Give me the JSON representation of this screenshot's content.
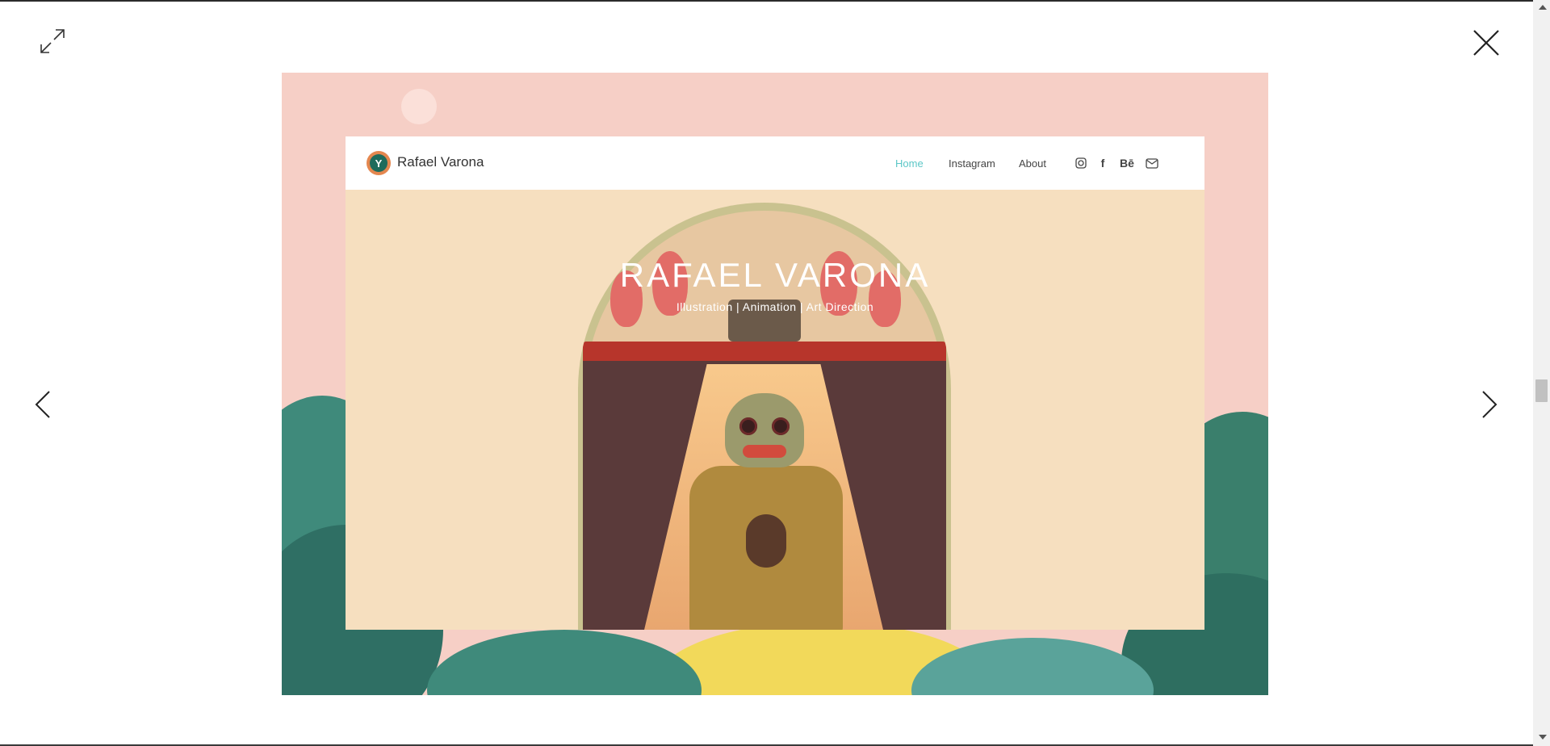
{
  "controls": {
    "expand_icon": "expand-arrows",
    "close_icon": "close-x",
    "prev_icon": "chevron-left",
    "next_icon": "chevron-right"
  },
  "image": {
    "site": {
      "brand": "Rafael Varona",
      "nav": [
        "Home",
        "Instagram",
        "About"
      ],
      "active_nav": "Home",
      "social_icons": [
        "instagram-icon",
        "facebook-icon",
        "behance-icon",
        "mail-icon"
      ],
      "behance_text": "Bē",
      "facebook_text": "f",
      "hero_title": "RAFAEL VARONA",
      "hero_subtitle": "Illustration | Animation | Art Direction"
    }
  },
  "colors": {
    "accent_nav": "#5cc7c7",
    "image_bg": "#f6cfc6",
    "mock_bg": "#f6dfbf"
  }
}
